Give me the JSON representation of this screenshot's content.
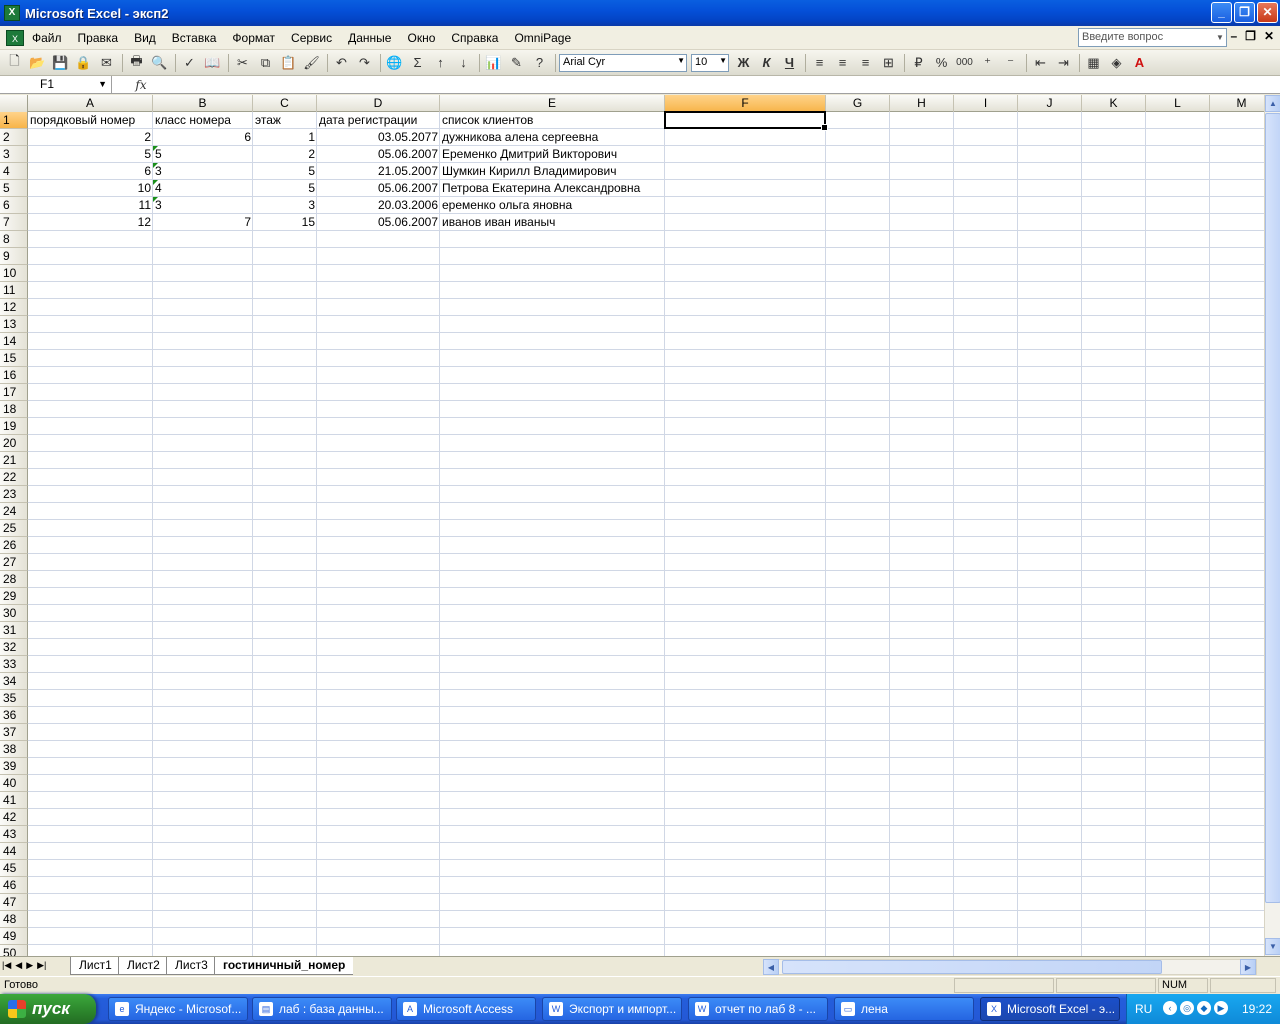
{
  "window": {
    "title": "Microsoft Excel - эксп2"
  },
  "menu": [
    "Файл",
    "Правка",
    "Вид",
    "Вставка",
    "Формат",
    "Сервис",
    "Данные",
    "Окно",
    "Справка",
    "OmniPage"
  ],
  "help_placeholder": "Введите вопрос",
  "toolbar": {
    "font_name": "Arial Cyr",
    "font_size": "10",
    "bold": "Ж",
    "italic": "К",
    "underline": "Ч",
    "percent": "%",
    "thousands": "000"
  },
  "formula_bar": {
    "name_box": "F1",
    "fx": "fx",
    "content": ""
  },
  "columns": [
    "A",
    "B",
    "C",
    "D",
    "E",
    "F",
    "G",
    "H",
    "I",
    "J",
    "K",
    "L",
    "M"
  ],
  "selected_cell": {
    "col": "F",
    "row": 1
  },
  "headers": [
    "порядковый номер",
    "класс номера",
    "этаж",
    "дата регистрации",
    "список клиентов"
  ],
  "rows": [
    {
      "a": "2",
      "b": "6",
      "b_text": false,
      "c": "1",
      "d": "03.05.2077",
      "e": "дужникова алена сергеевна"
    },
    {
      "a": "5",
      "b": "5",
      "b_text": true,
      "c": "2",
      "d": "05.06.2007",
      "e": "Еременко Дмитрий Викторович"
    },
    {
      "a": "6",
      "b": "3",
      "b_text": true,
      "c": "5",
      "d": "21.05.2007",
      "e": "Шумкин Кирилл Владимирович"
    },
    {
      "a": "10",
      "b": "4",
      "b_text": true,
      "c": "5",
      "d": "05.06.2007",
      "e": "Петрова Екатерина Александровна"
    },
    {
      "a": "11",
      "b": "3",
      "b_text": true,
      "c": "3",
      "d": "20.03.2006",
      "e": "еременко ольга яновна"
    },
    {
      "a": "12",
      "b": "7",
      "b_text": false,
      "c": "15",
      "d": "05.06.2007",
      "e": "иванов иван иваныч"
    }
  ],
  "row_count": 50,
  "sheets": [
    "Лист1",
    "Лист2",
    "Лист3",
    "гостиничный_номер"
  ],
  "active_sheet": "гостиничный_номер",
  "status": {
    "text": "Готово",
    "num": "NUM"
  },
  "taskbar": {
    "start": "пуск",
    "tasks": [
      "Яндекс - Microsof...",
      "лаб : база данны...",
      "Microsoft Access",
      "Экспорт и импорт...",
      "отчет по лаб 8 - ...",
      "лена",
      "Microsoft Excel - э..."
    ],
    "active_task": "Microsoft Excel - э...",
    "lang": "RU",
    "clock": "19:22"
  },
  "colors": {
    "title_blue": "#0550d8",
    "selected_header": "#f7b449",
    "grid_line": "#d0d7e5",
    "taskbar": "#245edb",
    "start_green": "#2e8a2e"
  }
}
